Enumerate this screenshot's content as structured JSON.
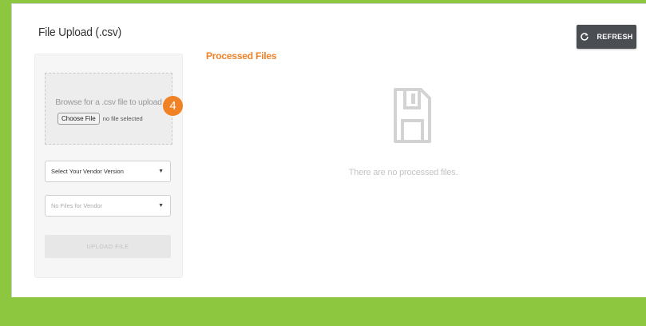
{
  "upload": {
    "title": "File Upload (.csv)",
    "drop_text": "Browse for a .csv file to upload",
    "choose_file_label": "Choose File",
    "no_file_text": "no file selected",
    "step_number": "4",
    "vendor_select_value": "Select Your Vendor Version",
    "files_select_value": "No Files for Vendor",
    "upload_button_label": "UPLOAD FILE"
  },
  "toolbar": {
    "refresh_label": "REFRESH"
  },
  "processed": {
    "title": "Processed Files",
    "empty_icon": "floppy-disk-icon",
    "empty_message": "There are no processed files."
  },
  "colors": {
    "background": "#8dc63f",
    "accent": "#f08125",
    "button_dark": "#4a4e52"
  }
}
